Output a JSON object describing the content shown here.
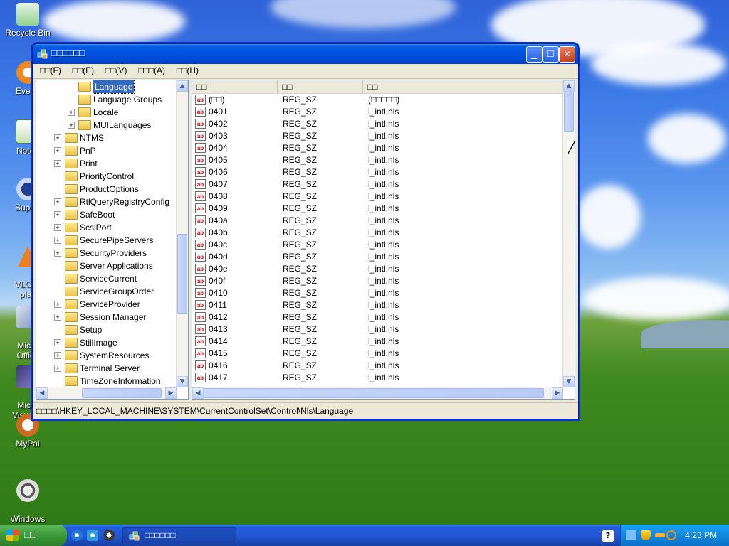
{
  "desktop": {
    "icons": [
      {
        "label": "Recycle Bin"
      },
      {
        "label": "Everyt"
      },
      {
        "label": "Notep"
      },
      {
        "label": "Superr"
      },
      {
        "label": "VLC m\nplay"
      },
      {
        "label": "Micro\nOffice"
      },
      {
        "label": "Micro\nVisual S"
      },
      {
        "label": "MyPal"
      },
      {
        "label": "Windows\nMovie Maker"
      }
    ]
  },
  "window": {
    "title": "□□□□□□",
    "menu": [
      "□□(F)",
      "□□(E)",
      "□□(V)",
      "□□□(A)",
      "□□(H)"
    ],
    "tree": [
      {
        "label": "Language",
        "indent": 2,
        "expander": false,
        "selected": true,
        "open": true
      },
      {
        "label": "Language Groups",
        "indent": 2,
        "expander": false
      },
      {
        "label": "Locale",
        "indent": 2,
        "expander": true
      },
      {
        "label": "MUILanguages",
        "indent": 2,
        "expander": true
      },
      {
        "label": "NTMS",
        "indent": 1,
        "expander": true
      },
      {
        "label": "PnP",
        "indent": 1,
        "expander": true
      },
      {
        "label": "Print",
        "indent": 1,
        "expander": true
      },
      {
        "label": "PriorityControl",
        "indent": 1,
        "expander": false
      },
      {
        "label": "ProductOptions",
        "indent": 1,
        "expander": false
      },
      {
        "label": "RtlQueryRegistryConfig",
        "indent": 1,
        "expander": true
      },
      {
        "label": "SafeBoot",
        "indent": 1,
        "expander": true
      },
      {
        "label": "ScsiPort",
        "indent": 1,
        "expander": true
      },
      {
        "label": "SecurePipeServers",
        "indent": 1,
        "expander": true
      },
      {
        "label": "SecurityProviders",
        "indent": 1,
        "expander": true
      },
      {
        "label": "Server Applications",
        "indent": 1,
        "expander": false
      },
      {
        "label": "ServiceCurrent",
        "indent": 1,
        "expander": false
      },
      {
        "label": "ServiceGroupOrder",
        "indent": 1,
        "expander": false
      },
      {
        "label": "ServiceProvider",
        "indent": 1,
        "expander": true
      },
      {
        "label": "Session Manager",
        "indent": 1,
        "expander": true
      },
      {
        "label": "Setup",
        "indent": 1,
        "expander": false
      },
      {
        "label": "StillImage",
        "indent": 1,
        "expander": true
      },
      {
        "label": "SystemResources",
        "indent": 1,
        "expander": true
      },
      {
        "label": "Terminal Server",
        "indent": 1,
        "expander": true
      },
      {
        "label": "TimeZoneInformation",
        "indent": 1,
        "expander": false
      }
    ],
    "columns": [
      "□□",
      "□□",
      "□□"
    ],
    "values": [
      {
        "name": "(□□)",
        "type": "REG_SZ",
        "data": "(□□□□□)"
      },
      {
        "name": "0401",
        "type": "REG_SZ",
        "data": "l_intl.nls"
      },
      {
        "name": "0402",
        "type": "REG_SZ",
        "data": "l_intl.nls"
      },
      {
        "name": "0403",
        "type": "REG_SZ",
        "data": "l_intl.nls"
      },
      {
        "name": "0404",
        "type": "REG_SZ",
        "data": "l_intl.nls"
      },
      {
        "name": "0405",
        "type": "REG_SZ",
        "data": "l_intl.nls"
      },
      {
        "name": "0406",
        "type": "REG_SZ",
        "data": "l_intl.nls"
      },
      {
        "name": "0407",
        "type": "REG_SZ",
        "data": "l_intl.nls"
      },
      {
        "name": "0408",
        "type": "REG_SZ",
        "data": "l_intl.nls"
      },
      {
        "name": "0409",
        "type": "REG_SZ",
        "data": "l_intl.nls"
      },
      {
        "name": "040a",
        "type": "REG_SZ",
        "data": "l_intl.nls"
      },
      {
        "name": "040b",
        "type": "REG_SZ",
        "data": "l_intl.nls"
      },
      {
        "name": "040c",
        "type": "REG_SZ",
        "data": "l_intl.nls"
      },
      {
        "name": "040d",
        "type": "REG_SZ",
        "data": "l_intl.nls"
      },
      {
        "name": "040e",
        "type": "REG_SZ",
        "data": "l_intl.nls"
      },
      {
        "name": "040f",
        "type": "REG_SZ",
        "data": "l_intl.nls"
      },
      {
        "name": "0410",
        "type": "REG_SZ",
        "data": "l_intl.nls"
      },
      {
        "name": "0411",
        "type": "REG_SZ",
        "data": "l_intl.nls"
      },
      {
        "name": "0412",
        "type": "REG_SZ",
        "data": "l_intl.nls"
      },
      {
        "name": "0413",
        "type": "REG_SZ",
        "data": "l_intl.nls"
      },
      {
        "name": "0414",
        "type": "REG_SZ",
        "data": "l_intl.nls"
      },
      {
        "name": "0415",
        "type": "REG_SZ",
        "data": "l_intl.nls"
      },
      {
        "name": "0416",
        "type": "REG_SZ",
        "data": "l_intl.nls"
      },
      {
        "name": "0417",
        "type": "REG_SZ",
        "data": "l_intl.nls"
      }
    ],
    "status": "□□□□\\HKEY_LOCAL_MACHINE\\SYSTEM\\CurrentControlSet\\Control\\Nls\\Language"
  },
  "taskbar": {
    "start_label": "□□",
    "task_label": "□□□□□□",
    "clock": "4:23 PM"
  }
}
